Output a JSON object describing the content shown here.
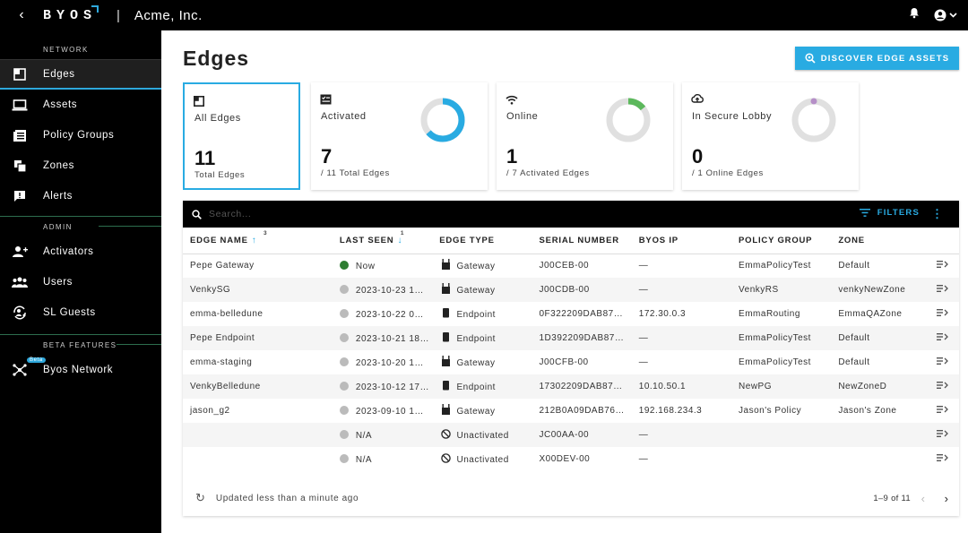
{
  "app": {
    "logo": "BYOS",
    "org": "Acme, Inc.",
    "separator": "|"
  },
  "sidebar": {
    "sections": [
      {
        "title": "NETWORK",
        "items": [
          {
            "label": "Edges",
            "icon": "edge-icon",
            "active": true
          },
          {
            "label": "Assets",
            "icon": "laptop-icon"
          },
          {
            "label": "Policy Groups",
            "icon": "policy-icon"
          },
          {
            "label": "Zones",
            "icon": "zones-icon"
          },
          {
            "label": "Alerts",
            "icon": "alert-icon"
          }
        ]
      },
      {
        "title": "ADMIN",
        "items": [
          {
            "label": "Activators",
            "icon": "person-add-icon"
          },
          {
            "label": "Users",
            "icon": "group-icon"
          },
          {
            "label": "SL Guests",
            "icon": "guests-icon"
          }
        ]
      },
      {
        "title": "BETA FEATURES",
        "items": [
          {
            "label": "Byos Network",
            "icon": "network-icon",
            "badge": "Beta"
          }
        ]
      }
    ]
  },
  "page": {
    "title": "Edges",
    "discover_button": "DISCOVER EDGE ASSETS"
  },
  "cards": [
    {
      "label": "All Edges",
      "count": "11",
      "sub": "Total Edges",
      "icon": "edge-icon"
    },
    {
      "label": "Activated",
      "count": "7",
      "sub": "/ 11 Total Edges",
      "icon": "checklist-icon",
      "fraction": 0.636,
      "color": "#29abe2"
    },
    {
      "label": "Online",
      "count": "1",
      "sub": "/ 7 Activated Edges",
      "icon": "wifi-icon",
      "fraction": 0.143,
      "color": "#5cb85c"
    },
    {
      "label": "In Secure Lobby",
      "count": "0",
      "sub": "/ 1 Online Edges",
      "icon": "lobby-icon",
      "fraction": 0,
      "color": "#b58fc7"
    }
  ],
  "table": {
    "search_placeholder": "Search...",
    "filters_label": "FILTERS",
    "columns": [
      "EDGE NAME",
      "LAST SEEN",
      "EDGE TYPE",
      "SERIAL NUMBER",
      "BYOS IP",
      "POLICY GROUP",
      "ZONE"
    ],
    "sort_badges": {
      "edge_name": "3",
      "last_seen": "1"
    },
    "rows": [
      {
        "name": "Pepe Gateway",
        "last_seen": "Now",
        "online": true,
        "type": "Gateway",
        "serial": "J00CEB-00",
        "ip": "—",
        "policy": "EmmaPolicyTest",
        "zone": "Default"
      },
      {
        "name": "VenkySG",
        "last_seen": "2023-10-23 1…",
        "online": false,
        "type": "Gateway",
        "serial": "J00CDB-00",
        "ip": "—",
        "policy": "VenkyRS",
        "zone": "venkyNewZone"
      },
      {
        "name": "emma-belledune",
        "last_seen": "2023-10-22 0…",
        "online": false,
        "type": "Endpoint",
        "serial": "0F322209DAB87…",
        "ip": "172.30.0.3",
        "policy": "EmmaRouting",
        "zone": "EmmaQAZone"
      },
      {
        "name": "Pepe Endpoint",
        "last_seen": "2023-10-21 18…",
        "online": false,
        "type": "Endpoint",
        "serial": "1D392209DAB87…",
        "ip": "—",
        "policy": "EmmaPolicyTest",
        "zone": "Default"
      },
      {
        "name": "emma-staging",
        "last_seen": "2023-10-20 1…",
        "online": false,
        "type": "Gateway",
        "serial": "J00CFB-00",
        "ip": "—",
        "policy": "EmmaPolicyTest",
        "zone": "Default"
      },
      {
        "name": "VenkyBelledune",
        "last_seen": "2023-10-12 17…",
        "online": false,
        "type": "Endpoint",
        "serial": "17302209DAB87…",
        "ip": "10.10.50.1",
        "policy": "NewPG",
        "zone": "NewZoneD"
      },
      {
        "name": "jason_g2",
        "last_seen": "2023-09-10 1…",
        "online": false,
        "type": "Gateway",
        "serial": "212B0A09DAB76…",
        "ip": "192.168.234.3",
        "policy": "Jason's Policy",
        "zone": "Jason's Zone"
      },
      {
        "name": "",
        "last_seen": "N/A",
        "online": false,
        "type": "Unactivated",
        "serial": "JC00AA-00",
        "ip": "—",
        "policy": "",
        "zone": ""
      },
      {
        "name": "",
        "last_seen": "N/A",
        "online": false,
        "type": "Unactivated",
        "serial": "X00DEV-00",
        "ip": "—",
        "policy": "",
        "zone": ""
      }
    ],
    "footer_updated": "Updated less than a minute ago",
    "pagination": "1–9 of 11"
  }
}
